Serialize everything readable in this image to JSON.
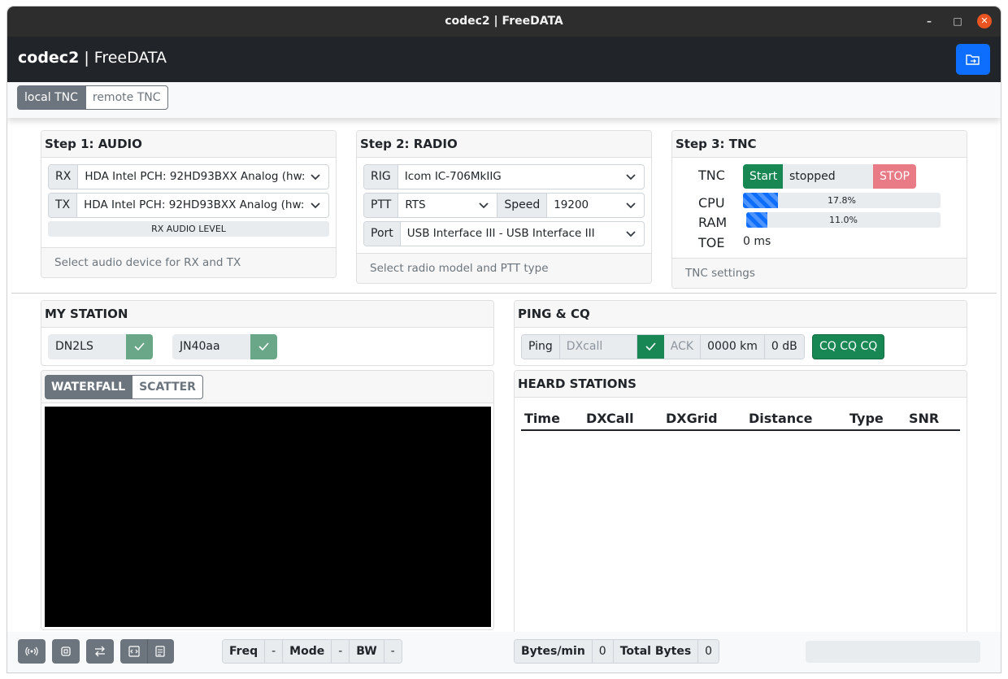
{
  "window": {
    "title": "codec2 | FreeDATA"
  },
  "navbar": {
    "brand_bold": "codec2",
    "brand_rest": " | FreeDATA"
  },
  "tnc_mode": {
    "local": "local TNC",
    "remote": "remote TNC",
    "selected": "local TNC"
  },
  "audio": {
    "header": "Step 1: AUDIO",
    "rx_label": "RX",
    "rx_value": "HDA Intel PCH: 92HD93BXX Analog (hw:",
    "tx_label": "TX",
    "tx_value": "HDA Intel PCH: 92HD93BXX Analog (hw:",
    "level_label": "RX AUDIO LEVEL",
    "footer": "Select audio device for RX and TX"
  },
  "radio": {
    "header": "Step 2: RADIO",
    "rig_label": "RIG",
    "rig_value": "Icom IC-706MkIIG",
    "ptt_label": "PTT",
    "ptt_value": "RTS",
    "speed_label": "Speed",
    "speed_value": "19200",
    "port_label": "Port",
    "port_value": "USB Interface III - USB Interface III",
    "footer": "Select radio model and PTT type"
  },
  "tnc": {
    "header": "Step 3: TNC",
    "tnc_label": "TNC",
    "start_label": "Start",
    "state": "stopped",
    "stop_label": "STOP",
    "cpu_label": "CPU",
    "cpu_text": "17.8%",
    "cpu_value": 0.178,
    "ram_label": "RAM",
    "ram_text": "11.0%",
    "ram_value": 0.11,
    "toe_label": "TOE",
    "toe_value": "0 ms",
    "footer": "TNC settings"
  },
  "my_station": {
    "header": "MY STATION",
    "callsign": "DN2LS",
    "grid": "JN40aa"
  },
  "display_tabs": {
    "waterfall": "WATERFALL",
    "scatter": "SCATTER",
    "selected": "WATERFALL"
  },
  "ping_cq": {
    "header": "PING & CQ",
    "ping_label": "Ping",
    "dxcall_placeholder": "DXcall",
    "ack_label": "ACK",
    "distance": "0000 km",
    "snr": "0 dB",
    "cq_label": "CQ CQ CQ"
  },
  "heard": {
    "header": "HEARD STATIONS",
    "columns": [
      "Time",
      "DXCall",
      "DXGrid",
      "Distance",
      "Type",
      "SNR"
    ],
    "rows": []
  },
  "footer": {
    "freq_label": "Freq",
    "freq_value": "-",
    "mode_label": "Mode",
    "mode_value": "-",
    "bw_label": "BW",
    "bw_value": "-",
    "bytes_label": "Bytes/min",
    "bytes_value": "0",
    "total_label": "Total Bytes",
    "total_value": "0",
    "icons": [
      "antenna-icon",
      "cpu-chip-icon",
      "swap-arrows-icon",
      "code-file-icon",
      "log-file-icon"
    ]
  },
  "colors": {
    "primary": "#0d6efd",
    "success": "#198754",
    "secondary": "#6c757d",
    "danger_light": "#e87b85",
    "navbar": "#212529"
  }
}
